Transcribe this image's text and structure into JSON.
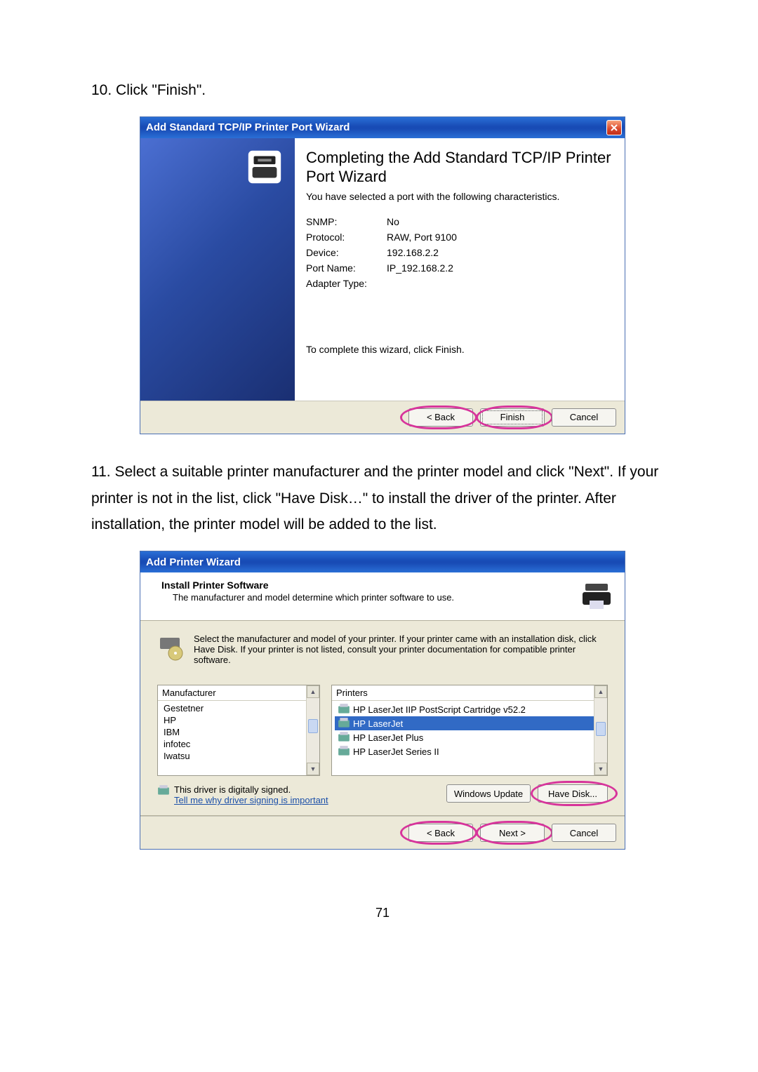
{
  "step10": {
    "text": "10. Click \"Finish\"."
  },
  "dialog1": {
    "title": "Add Standard TCP/IP Printer Port Wizard",
    "heading": "Completing the Add Standard TCP/IP Printer Port Wizard",
    "subtext": "You have selected a port with the following characteristics.",
    "rows": {
      "snmp_label": "SNMP:",
      "snmp_val": "No",
      "protocol_label": "Protocol:",
      "protocol_val": "RAW, Port 9100",
      "device_label": "Device:",
      "device_val": "192.168.2.2",
      "portname_label": "Port Name:",
      "portname_val": "IP_192.168.2.2",
      "adapter_label": "Adapter Type:",
      "adapter_val": ""
    },
    "complete": "To complete this wizard, click Finish.",
    "buttons": {
      "back": "< Back",
      "finish": "Finish",
      "cancel": "Cancel"
    }
  },
  "step11": {
    "text": "11. Select a suitable printer manufacturer and the printer model and click \"Next\". If your printer is not in the list, click \"Have Disk…\" to install the driver of the printer. After installation, the printer model will be added to the list."
  },
  "dialog2": {
    "title": "Add Printer Wizard",
    "header_title": "Install Printer Software",
    "header_sub": "The manufacturer and model determine which printer software to use.",
    "instruction": "Select the manufacturer and model of your printer. If your printer came with an installation disk, click Have Disk. If your printer is not listed, consult your printer documentation for compatible printer software.",
    "mfr_header": "Manufacturer",
    "mfr_items": [
      "Gestetner",
      "HP",
      "IBM",
      "infotec",
      "Iwatsu"
    ],
    "prt_header": "Printers",
    "prt_items": [
      "HP LaserJet IIP PostScript Cartridge v52.2",
      "HP LaserJet",
      "HP LaserJet Plus",
      "HP LaserJet Series II"
    ],
    "prt_selected_index": 1,
    "signed_text": "This driver is digitally signed.",
    "signed_link": "Tell me why driver signing is important",
    "buttons": {
      "windows_update": "Windows Update",
      "have_disk": "Have Disk...",
      "back": "< Back",
      "next": "Next >",
      "cancel": "Cancel"
    }
  },
  "page_number": "71"
}
